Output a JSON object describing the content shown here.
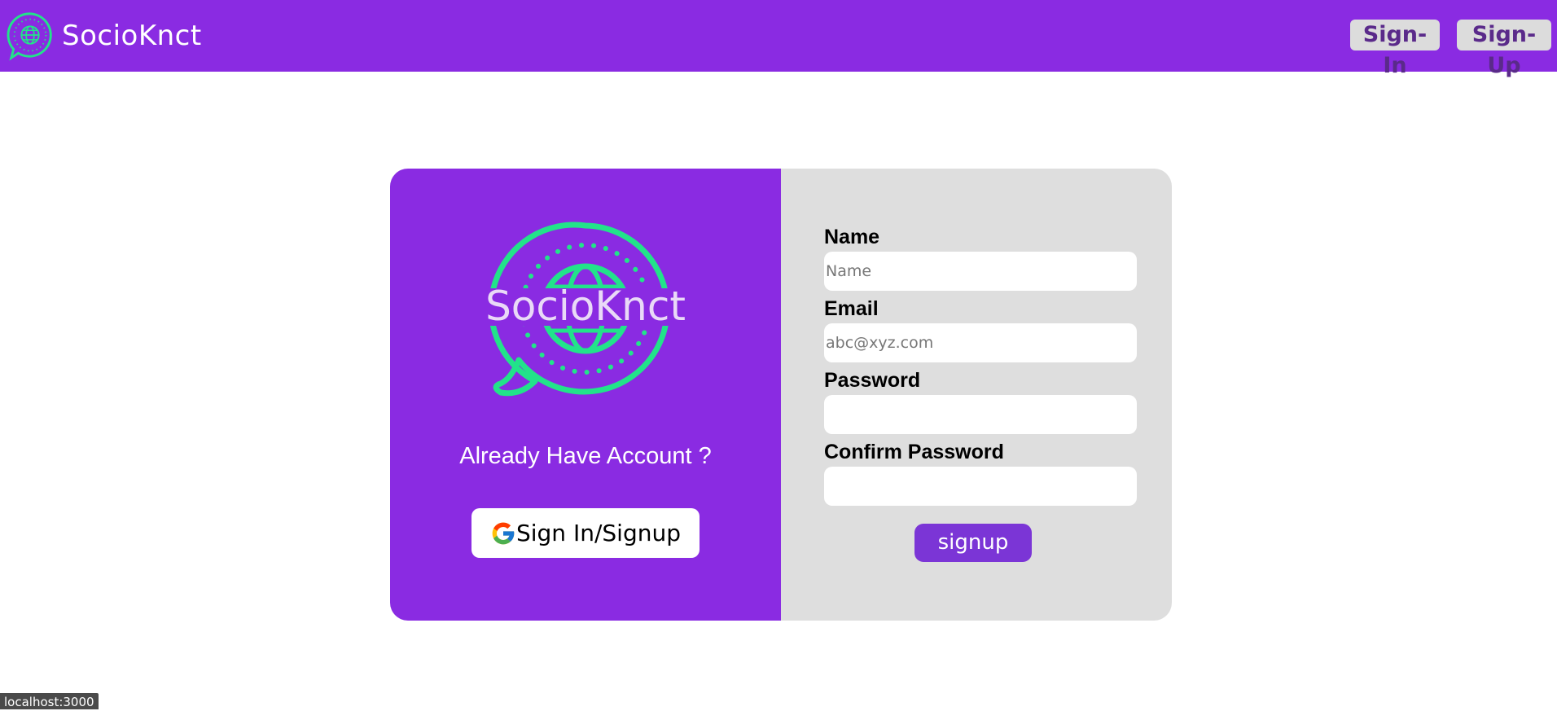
{
  "navbar": {
    "brand_name": "SocioKnct",
    "sign_in_label": "Sign-In",
    "sign_up_label": "Sign-Up",
    "background": "#8a2be2"
  },
  "card": {
    "logo_text": "SocioKnct",
    "already_text": "Already Have Account ?",
    "google_button_label": "Sign In/Signup",
    "form": {
      "name_label": "Name",
      "name_placeholder": "Name",
      "email_label": "Email",
      "email_placeholder": "abc@xyz.com",
      "password_label": "Password",
      "password_value": "",
      "confirm_password_label": "Confirm Password",
      "confirm_password_value": "",
      "signup_label": "signup"
    }
  },
  "status_bar": {
    "url": "localhost:3000"
  },
  "colors": {
    "brand_purple": "#8a2be2",
    "logo_green": "#22e38a",
    "panel_gray": "#dedede",
    "signup_button": "#7b35d6"
  },
  "icons": {
    "brand_logo": "globe-chat-bubble-icon",
    "google": "google-g-icon"
  }
}
